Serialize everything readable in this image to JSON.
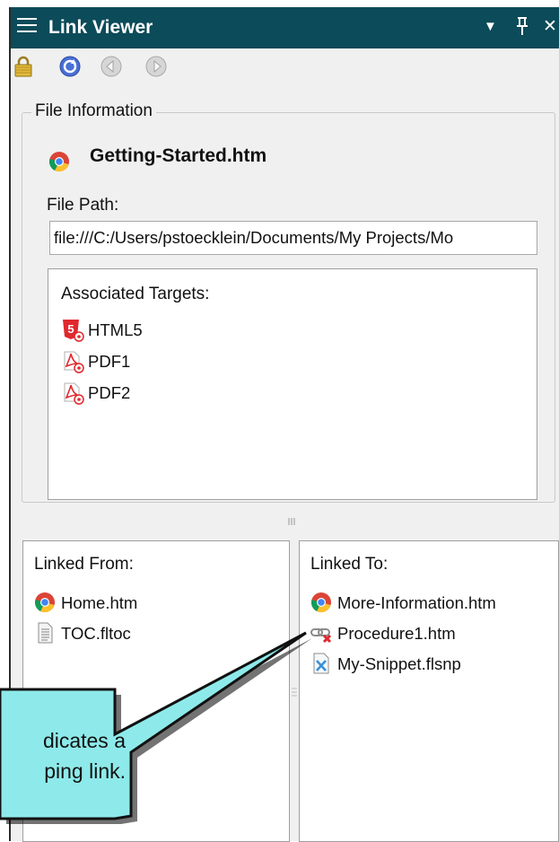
{
  "panel": {
    "title": "Link Viewer",
    "title_buttons": {
      "dropdown": "▼",
      "pin": "🖈",
      "close": "✕"
    }
  },
  "toolbar": {
    "items": [
      {
        "icon": "lock-icon"
      },
      {
        "icon": "refresh-icon"
      },
      {
        "icon": "back-icon"
      },
      {
        "icon": "forward-icon"
      }
    ]
  },
  "file_info": {
    "group_label": "File Information",
    "file_name": "Getting-Started.htm",
    "path_label": "File Path:",
    "path_value": "file:///C:/Users/pstoecklein/Documents/My Projects/Mo",
    "targets_label": "Associated Targets:",
    "targets": [
      {
        "label": "HTML5",
        "icon": "html5-target-icon"
      },
      {
        "label": "PDF1",
        "icon": "pdf-target-icon"
      },
      {
        "label": "PDF2",
        "icon": "pdf-target-icon"
      }
    ]
  },
  "linked_from": {
    "title": "Linked From:",
    "items": [
      {
        "label": "Home.htm",
        "icon": "chrome-icon"
      },
      {
        "label": "TOC.fltoc",
        "icon": "toc-file-icon"
      }
    ]
  },
  "linked_to": {
    "title": "Linked To:",
    "items": [
      {
        "label": "More-Information.htm",
        "icon": "chrome-icon"
      },
      {
        "label": "Procedure1.htm",
        "icon": "broken-link-icon"
      },
      {
        "label": "My-Snippet.flsnp",
        "icon": "snippet-icon"
      }
    ]
  },
  "callout": {
    "line1": "dicates a",
    "line2": "ping link."
  },
  "colors": {
    "titlebar": "#0c4b59",
    "callout_fill": "#8eeaea",
    "target_red": "#e0282e"
  }
}
